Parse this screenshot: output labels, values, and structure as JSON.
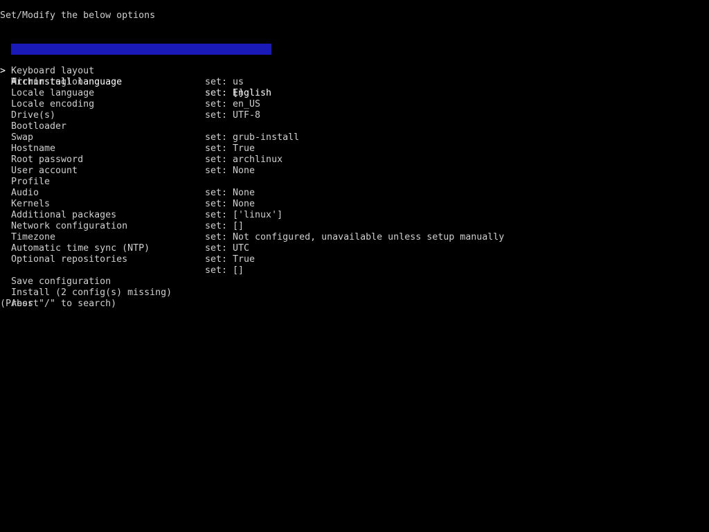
{
  "header": {
    "title": "Set/Modify the below options"
  },
  "cursor": {
    "glyph": ">"
  },
  "colors": {
    "background": "#000000",
    "text": "#cfcfcf",
    "selection": "#1a1ab8"
  },
  "options": [
    {
      "label": "Archinstall language",
      "value": "set: English",
      "selected": true
    },
    {
      "label": "Keyboard layout",
      "value": "set: us"
    },
    {
      "label": "Mirror region",
      "value": "set: []"
    },
    {
      "label": "Locale language",
      "value": "set: en_US"
    },
    {
      "label": "Locale encoding",
      "value": "set: UTF-8"
    },
    {
      "label": "Drive(s)",
      "value": ""
    },
    {
      "label": "Bootloader",
      "value": "set: grub-install"
    },
    {
      "label": "Swap",
      "value": "set: True"
    },
    {
      "label": "Hostname",
      "value": "set: archlinux"
    },
    {
      "label": "Root password",
      "value": "set: None"
    },
    {
      "label": "User account",
      "value": ""
    },
    {
      "label": "Profile",
      "value": "set: None"
    },
    {
      "label": "Audio",
      "value": "set: None"
    },
    {
      "label": "Kernels",
      "value": "set: ['linux']"
    },
    {
      "label": "Additional packages",
      "value": "set: []"
    },
    {
      "label": "Network configuration",
      "value": "set: Not configured, unavailable unless setup manually"
    },
    {
      "label": "Timezone",
      "value": "set: UTC"
    },
    {
      "label": "Automatic time sync (NTP)",
      "value": "set: True"
    },
    {
      "label": "Optional repositories",
      "value": "set: []"
    }
  ],
  "actions": [
    {
      "label": "Save configuration"
    },
    {
      "label": "Install (2 config(s) missing)"
    },
    {
      "label": "Abort"
    }
  ],
  "footer": {
    "hint": "(Press \"/\" to search)"
  }
}
